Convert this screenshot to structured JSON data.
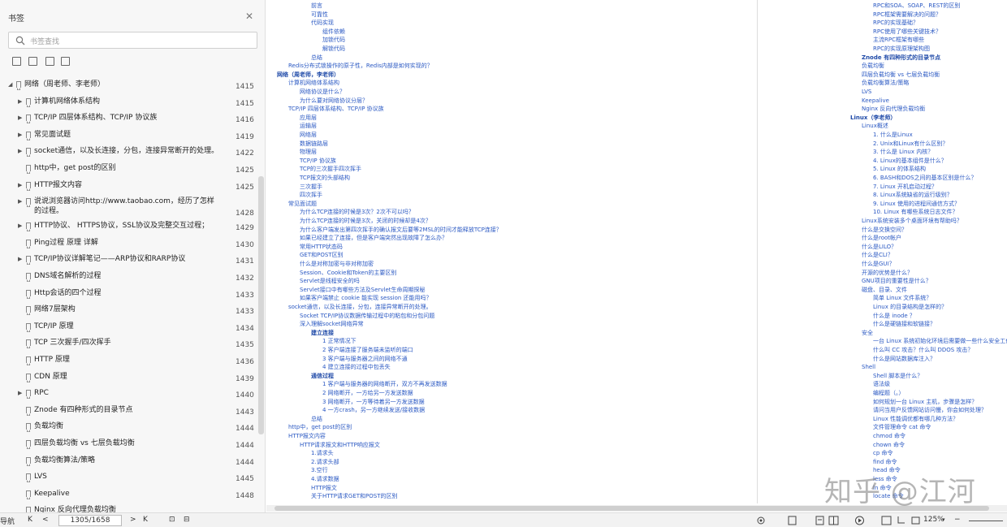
{
  "sidebar": {
    "title": "书签",
    "close_glyph": "✕",
    "search_placeholder": "书签查找",
    "tools": [
      "expand-all-icon",
      "collapse-all-icon",
      "add-bookmark-icon",
      "bookmark-list-icon"
    ],
    "items": [
      {
        "label": "网络（周老师、李老师）",
        "page": "1415",
        "level": 0,
        "arrow": "◢"
      },
      {
        "label": "计算机网络体系结构",
        "page": "1415",
        "level": 1,
        "arrow": "▶"
      },
      {
        "label": "TCP/IP 四层体系结构、TCP/IP 协议族",
        "page": "1416",
        "level": 1,
        "arrow": "▶"
      },
      {
        "label": "常见面试题",
        "page": "1419",
        "level": 1,
        "arrow": "▶"
      },
      {
        "label": "socket通信，以及长连接，分包，连接异常断开的处理。",
        "page": "1422",
        "level": 1,
        "arrow": "▶"
      },
      {
        "label": "http中，get post的区别",
        "page": "1425",
        "level": 1,
        "arrow": ""
      },
      {
        "label": "HTTP报文内容",
        "page": "1425",
        "level": 1,
        "arrow": "▶"
      },
      {
        "label": "说说浏览器访问http://www.taobao.com，经历了怎样的过程。",
        "page": "1428",
        "level": 1,
        "arrow": "▶"
      },
      {
        "label": "HTTP协议、 HTTPS协议，SSL协议及完整交互过程；",
        "page": "1429",
        "level": 1,
        "arrow": "▶"
      },
      {
        "label": "Ping过程 原理 详解",
        "page": "1430",
        "level": 1,
        "arrow": ""
      },
      {
        "label": "TCP/IP协议详解笔记——ARP协议和RARP协议",
        "page": "1431",
        "level": 1,
        "arrow": "▶"
      },
      {
        "label": "DNS域名解析的过程",
        "page": "1432",
        "level": 1,
        "arrow": ""
      },
      {
        "label": "Http会话的四个过程",
        "page": "1433",
        "level": 1,
        "arrow": ""
      },
      {
        "label": "网络7层架构",
        "page": "1433",
        "level": 1,
        "arrow": ""
      },
      {
        "label": "TCP/IP 原理",
        "page": "1434",
        "level": 1,
        "arrow": ""
      },
      {
        "label": "TCP 三次握手/四次挥手",
        "page": "1435",
        "level": 1,
        "arrow": ""
      },
      {
        "label": "HTTP 原理",
        "page": "1436",
        "level": 1,
        "arrow": ""
      },
      {
        "label": "CDN 原理",
        "page": "1439",
        "level": 1,
        "arrow": ""
      },
      {
        "label": "RPC",
        "page": "1440",
        "level": 1,
        "arrow": "▶"
      },
      {
        "label": "Znode 有四种形式的目录节点",
        "page": "1443",
        "level": 1,
        "arrow": ""
      },
      {
        "label": "负载均衡",
        "page": "1444",
        "level": 1,
        "arrow": ""
      },
      {
        "label": "四层负载均衡 vs 七层负载均衡",
        "page": "1444",
        "level": 1,
        "arrow": ""
      },
      {
        "label": "负载均衡算法/策略",
        "page": "1444",
        "level": 1,
        "arrow": ""
      },
      {
        "label": "LVS",
        "page": "1445",
        "level": 1,
        "arrow": ""
      },
      {
        "label": "Keepalive",
        "page": "1448",
        "level": 1,
        "arrow": ""
      },
      {
        "label": "Nginx 反向代理负载均衡",
        "page": "",
        "level": 1,
        "arrow": ""
      }
    ]
  },
  "page1": [
    {
      "t": "前言",
      "i": 3,
      "b": false
    },
    {
      "t": "可靠性",
      "i": 3,
      "b": false
    },
    {
      "t": "代码实现",
      "i": 3,
      "b": false
    },
    {
      "t": "组件依赖",
      "i": 4,
      "b": false
    },
    {
      "t": "加锁代码",
      "i": 4,
      "b": false
    },
    {
      "t": "解锁代码",
      "i": 4,
      "b": false
    },
    {
      "t": "总结",
      "i": 3,
      "b": false
    },
    {
      "t": "Redis分布式锁操作的原子性，Redis内部是如何实现的？",
      "i": 1,
      "b": false
    },
    {
      "t": "网络（周老师，李老师）",
      "i": 0,
      "b": true
    },
    {
      "t": "计算机网络体系结构",
      "i": 1,
      "b": false
    },
    {
      "t": "网络协议是什么？",
      "i": 2,
      "b": false
    },
    {
      "t": "为什么要对网络协议分层？",
      "i": 2,
      "b": false
    },
    {
      "t": "TCP/IP 四层体系结构、TCP/IP 协议族",
      "i": 1,
      "b": false
    },
    {
      "t": "应用层",
      "i": 2,
      "b": false
    },
    {
      "t": "运输层",
      "i": 2,
      "b": false
    },
    {
      "t": "网络层",
      "i": 2,
      "b": false
    },
    {
      "t": "数据链路层",
      "i": 2,
      "b": false
    },
    {
      "t": "物理层",
      "i": 2,
      "b": false
    },
    {
      "t": "TCP/IP 协议族",
      "i": 2,
      "b": false
    },
    {
      "t": "TCP的三次握手四次挥手",
      "i": 2,
      "b": false
    },
    {
      "t": "TCP报文的头部结构",
      "i": 2,
      "b": false
    },
    {
      "t": "三次握手",
      "i": 2,
      "b": false
    },
    {
      "t": "四次挥手",
      "i": 2,
      "b": false
    },
    {
      "t": "常见面试题",
      "i": 1,
      "b": false
    },
    {
      "t": "为什么TCP连接的时候是3次？2次不可以吗？",
      "i": 2,
      "b": false
    },
    {
      "t": "为什么TCP连接的时候是3次，关闭的时候却是4次？",
      "i": 2,
      "b": false
    },
    {
      "t": "为什么客户端发出第四次挥手的确认报文后要等2MSL的时间才能释放TCP连接？",
      "i": 2,
      "b": false
    },
    {
      "t": "如果已经建立了连接，但是客户端突然出现故障了怎么办？",
      "i": 2,
      "b": false
    },
    {
      "t": "常用HTTP状态码",
      "i": 2,
      "b": false
    },
    {
      "t": "GET和POST区别",
      "i": 2,
      "b": false
    },
    {
      "t": "什么是对称加密与非对称加密",
      "i": 2,
      "b": false
    },
    {
      "t": "Session、Cookie和Token的主要区别",
      "i": 2,
      "b": false
    },
    {
      "t": "Servlet是线程安全的吗",
      "i": 2,
      "b": false
    },
    {
      "t": "Servlet接口中有哪些方法及Servlet生命周期探秘",
      "i": 2,
      "b": false
    },
    {
      "t": "如果客户端禁止 cookie 能实现 session 还能用吗？",
      "i": 2,
      "b": false
    },
    {
      "t": "socket通信，以及长连接，分包，连接异常断开的处理。",
      "i": 1,
      "b": false
    },
    {
      "t": "Socket TCP/IP协议数据传输过程中的粘包和分包问题",
      "i": 2,
      "b": false
    },
    {
      "t": "深入理解socket网络异常",
      "i": 2,
      "b": false
    },
    {
      "t": "建立连接",
      "i": 3,
      "b": true
    },
    {
      "t": "1 正常情况下",
      "i": 4,
      "b": false
    },
    {
      "t": "2 客户端连接了服务端未监听的端口",
      "i": 4,
      "b": false
    },
    {
      "t": "3 客户端与服务器之间的网络不通",
      "i": 4,
      "b": false
    },
    {
      "t": "4 建立连接的过程中包丢失",
      "i": 4,
      "b": false
    },
    {
      "t": "通信过程",
      "i": 3,
      "b": true
    },
    {
      "t": "1 客户端与服务器的网络断开，双方不再发送数据",
      "i": 4,
      "b": false
    },
    {
      "t": "2 网络断开，一方给另一方发送数据",
      "i": 4,
      "b": false
    },
    {
      "t": "3 网络断开，一方等待着另一方发送数据",
      "i": 4,
      "b": false
    },
    {
      "t": "4 一方crash，另一方继续发送/接收数据",
      "i": 4,
      "b": false
    },
    {
      "t": "总结",
      "i": 3,
      "b": false
    },
    {
      "t": "http中，get post的区别",
      "i": 1,
      "b": false
    },
    {
      "t": "HTTP报文内容",
      "i": 1,
      "b": false
    },
    {
      "t": "HTTP请求报文和HTTP响应报文",
      "i": 2,
      "b": false
    },
    {
      "t": "1.请求头",
      "i": 3,
      "b": false
    },
    {
      "t": "2.请求头部",
      "i": 3,
      "b": false
    },
    {
      "t": "3.空行",
      "i": 3,
      "b": false
    },
    {
      "t": "4.请求数据",
      "i": 3,
      "b": false
    },
    {
      "t": "HTTP报文",
      "i": 3,
      "b": false
    },
    {
      "t": "关于HTTP请求GET和POST的区别",
      "i": 3,
      "b": false
    }
  ],
  "page2": [
    {
      "t": "RPC和SOA、SOAP、REST的区别",
      "i": 2,
      "b": false
    },
    {
      "t": "RPC框架需要解决的问题？",
      "i": 2,
      "b": false
    },
    {
      "t": "RPC的实现基础？",
      "i": 2,
      "b": false
    },
    {
      "t": "RPC使用了哪些关键技术？",
      "i": 2,
      "b": false
    },
    {
      "t": "主流RPC框架有哪些",
      "i": 2,
      "b": false
    },
    {
      "t": "RPC的实现原理架构图",
      "i": 2,
      "b": false
    },
    {
      "t": "Znode 有四种形式的目录节点",
      "i": 1,
      "b": true
    },
    {
      "t": "负载均衡",
      "i": 1,
      "b": false
    },
    {
      "t": "四层负载均衡 vs 七层负载均衡",
      "i": 1,
      "b": false
    },
    {
      "t": "负载均衡算法/策略",
      "i": 1,
      "b": false
    },
    {
      "t": "LVS",
      "i": 1,
      "b": false
    },
    {
      "t": "Keepalive",
      "i": 1,
      "b": false
    },
    {
      "t": "Nginx 反向代理负载均衡",
      "i": 1,
      "b": false
    },
    {
      "t": "Linux（李老师）",
      "i": 0,
      "b": true
    },
    {
      "t": "Linux概述",
      "i": 1,
      "b": false
    },
    {
      "t": "1. 什么是Linux",
      "i": 2,
      "b": false
    },
    {
      "t": "2. Unix和Linux有什么区别？",
      "i": 2,
      "b": false
    },
    {
      "t": "3. 什么是 Linux 内核？",
      "i": 2,
      "b": false
    },
    {
      "t": "4. Linux的基本组件是什么？",
      "i": 2,
      "b": false
    },
    {
      "t": "5. Linux 的体系结构",
      "i": 2,
      "b": false
    },
    {
      "t": "6. BASH和DOS之间的基本区别是什么？",
      "i": 2,
      "b": false
    },
    {
      "t": "7. Linux 开机启动过程？",
      "i": 2,
      "b": false
    },
    {
      "t": "8. Linux系统缺省的运行级别？",
      "i": 2,
      "b": false
    },
    {
      "t": "9. Linux 使用的进程间通信方式？",
      "i": 2,
      "b": false
    },
    {
      "t": "10. Linux 有哪些系统日志文件？",
      "i": 2,
      "b": false
    },
    {
      "t": "Linux系统安装多个桌面环境有帮助吗？",
      "i": 1,
      "b": false
    },
    {
      "t": "什么是交换空间？",
      "i": 1,
      "b": false
    },
    {
      "t": "什么是root帐户",
      "i": 1,
      "b": false
    },
    {
      "t": "什么是LILO？",
      "i": 1,
      "b": false
    },
    {
      "t": "什么是CLI？",
      "i": 1,
      "b": false
    },
    {
      "t": "什么是GUI？",
      "i": 1,
      "b": false
    },
    {
      "t": "开源的优势是什么？",
      "i": 1,
      "b": false
    },
    {
      "t": "GNU项目的重要性是什么？",
      "i": 1,
      "b": false
    },
    {
      "t": "磁盘、目录、文件",
      "i": 1,
      "b": false
    },
    {
      "t": "简单 Linux 文件系统？",
      "i": 2,
      "b": false
    },
    {
      "t": "Linux 的目录结构是怎样的？",
      "i": 2,
      "b": false
    },
    {
      "t": "什么是 inode ？",
      "i": 2,
      "b": false
    },
    {
      "t": "什么是硬链接和软链接？",
      "i": 2,
      "b": false
    },
    {
      "t": "安全",
      "i": 1,
      "b": false
    },
    {
      "t": "一台 Linux 系统初始化环境后需要做一些什么安全工作？",
      "i": 2,
      "b": false
    },
    {
      "t": "什么叫 CC 攻击？什么叫 DDOS 攻击？",
      "i": 2,
      "b": false
    },
    {
      "t": "什么是网站数据库注入？",
      "i": 2,
      "b": false
    },
    {
      "t": "Shell",
      "i": 1,
      "b": false
    },
    {
      "t": "Shell 脚本是什么？",
      "i": 2,
      "b": false
    },
    {
      "t": "语法级",
      "i": 2,
      "b": false
    },
    {
      "t": "编程题（。）",
      "i": 2,
      "b": false
    },
    {
      "t": "如何规划一台 Linux 主机，步骤是怎样？",
      "i": 2,
      "b": false
    },
    {
      "t": "请问当用户反馈网站访问慢，你会如何处理？",
      "i": 2,
      "b": false
    },
    {
      "t": "Linux 性能调优都有哪几种方法？",
      "i": 2,
      "b": false
    },
    {
      "t": "文件管理命令 cat 命令",
      "i": 2,
      "b": false
    },
    {
      "t": "chmod 命令",
      "i": 2,
      "b": false
    },
    {
      "t": "chown 命令",
      "i": 2,
      "b": false
    },
    {
      "t": "cp 命令",
      "i": 2,
      "b": false
    },
    {
      "t": "find 命令",
      "i": 2,
      "b": false
    },
    {
      "t": "head 命令",
      "i": 2,
      "b": false
    },
    {
      "t": "less 命令",
      "i": 2,
      "b": false
    },
    {
      "t": "ln 命令",
      "i": 2,
      "b": false
    },
    {
      "t": "locate 命令",
      "i": 2,
      "b": false
    }
  ],
  "watermark": "知乎 @江河",
  "status": {
    "nav_label": "导航",
    "first_page": "K",
    "prev_page": "<",
    "page_value": "1305/1658",
    "next_page": ">",
    "last_page": "K",
    "fit_icon_1": "⊡",
    "fit_icon_2": "⊟",
    "zoom": "125%",
    "zoom_minus": "−"
  }
}
